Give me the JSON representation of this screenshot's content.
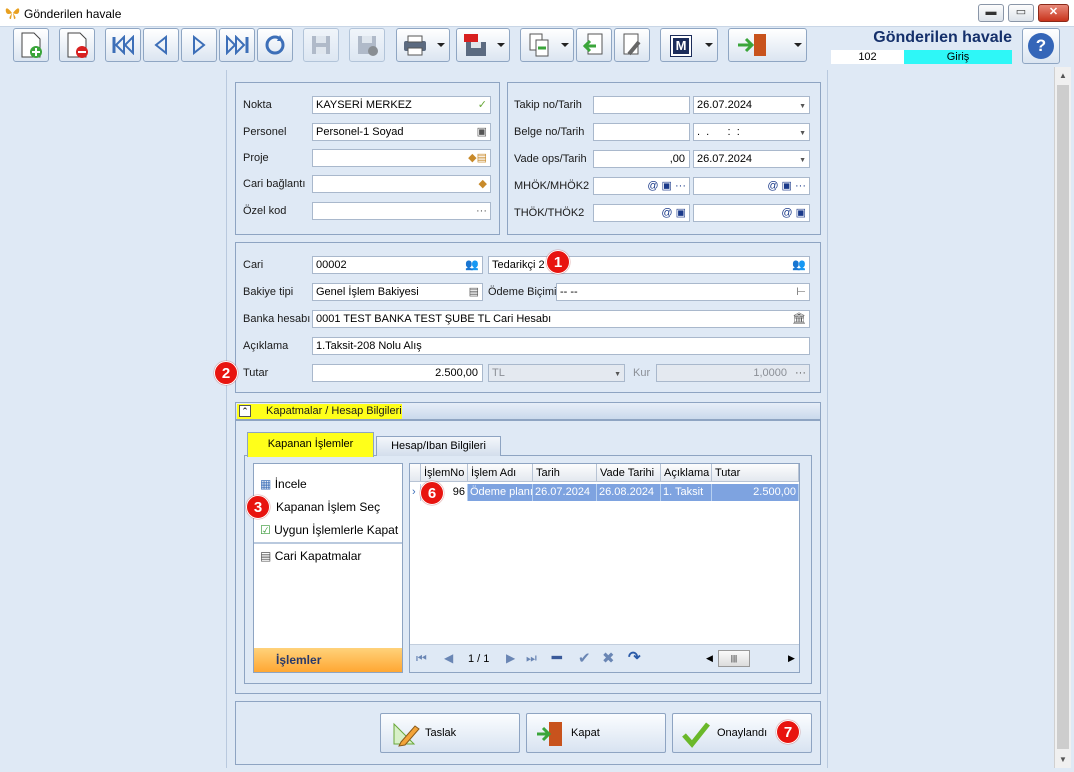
{
  "window": {
    "title": "Gönderilen havale",
    "minimize": "▬",
    "maximize": "▭",
    "close": "✕"
  },
  "header": {
    "title": "Gönderilen havale",
    "code": "102",
    "mode": "Giriş",
    "help": "?"
  },
  "toolbar": {
    "m_label": "M"
  },
  "form_top_left": {
    "nokta": {
      "label": "Nokta",
      "value": "KAYSERİ MERKEZ"
    },
    "personel": {
      "label": "Personel",
      "value": "Personel-1 Soyad"
    },
    "proje": {
      "label": "Proje",
      "value": ""
    },
    "cari_baglanti": {
      "label": "Cari bağlantı",
      "value": ""
    },
    "ozel_kod": {
      "label": "Özel kod",
      "value": "",
      "dots": "···"
    }
  },
  "form_top_right": {
    "takip": {
      "label": "Takip no/Tarih",
      "no": "",
      "date": "26.07.2024"
    },
    "belge": {
      "label": "Belge no/Tarih",
      "no": "",
      "date": ".  .      :  :"
    },
    "vade": {
      "label": "Vade ops/Tarih",
      "ops": ",00",
      "date": "26.07.2024"
    },
    "mhok": {
      "label": "MHÖK/MHÖK2"
    },
    "thok": {
      "label": "THÖK/THÖK2"
    }
  },
  "form_main": {
    "cari": {
      "label": "Cari",
      "code": "00002",
      "name": "Tedarikçi 2"
    },
    "bakiye": {
      "label": "Bakiye tipi",
      "value": "Genel İşlem Bakiyesi"
    },
    "odeme": {
      "label": "Ödeme Biçimi",
      "value": "-- --"
    },
    "banka": {
      "label": "Banka hesabı",
      "value": "0001 TEST BANKA TEST ŞUBE TL Cari Hesabı"
    },
    "aciklama": {
      "label": "Açıklama",
      "value": "1.Taksit-208 Nolu Alış"
    },
    "tutar": {
      "label": "Tutar",
      "value": "2.500,00",
      "currency": "TL"
    },
    "kur": {
      "label": "Kur",
      "value": "1,0000"
    }
  },
  "section": {
    "title": "Kapatmalar / Hesap Bilgileri"
  },
  "tabs": [
    {
      "label": "Kapanan İşlemler"
    },
    {
      "label": "Hesap/Iban Bilgileri"
    }
  ],
  "actions": {
    "items": [
      {
        "label": "İncele"
      },
      {
        "label": "Kapanan İşlem Seç"
      },
      {
        "label": "Uygun İşlemlerle Kapat"
      },
      {
        "label": "Cari Kapatmalar"
      }
    ],
    "footer": "İşlemler"
  },
  "grid": {
    "columns": [
      "İşlemNo",
      "İşlem Adı",
      "Tarih",
      "Vade Tarihi",
      "Açıklama",
      "Tutar"
    ],
    "rows": [
      {
        "islem_no": "96",
        "islem_adi": "Ödeme planı",
        "tarih": "26.07.2024",
        "vade": "26.08.2024",
        "aciklama": "1. Taksit",
        "tutar": "2.500,00"
      }
    ],
    "pager": "1 / 1"
  },
  "buttons": {
    "taslak": "Taslak",
    "kapat": "Kapat",
    "onaylandi": "Onaylandı"
  },
  "badges": [
    "1",
    "2",
    "3",
    "6",
    "7"
  ],
  "colors": {
    "mode_bg": "#2ef7f7",
    "highlight": "#ffff1a",
    "badge": "#e8140f",
    "selected_row": "#7ea3e0",
    "footer_orange": "#ffb347"
  }
}
